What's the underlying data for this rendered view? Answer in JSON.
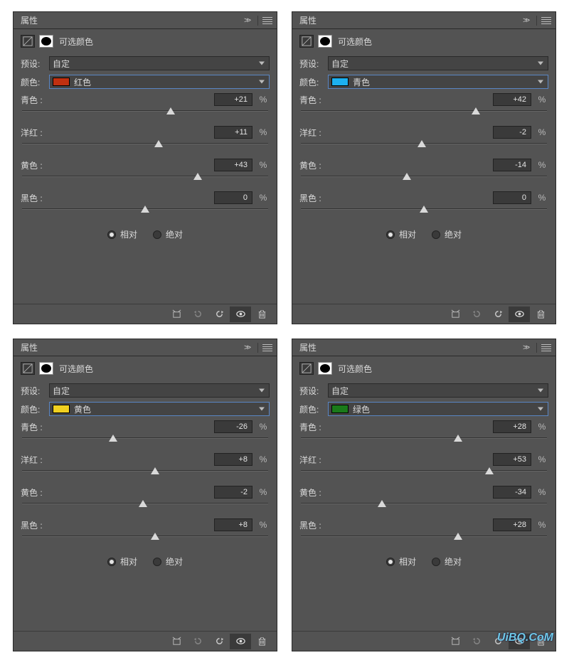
{
  "ui": {
    "panel_title": "属性",
    "subtitle": "可选颜色",
    "preset_label": "预设:",
    "preset_value": "自定",
    "color_label": "颜色:",
    "cyan_label": "青色 :",
    "magenta_label": "洋红 :",
    "yellow_label": "黄色 :",
    "black_label": "黑色 :",
    "relative": "相对",
    "absolute": "绝对",
    "percent": "%"
  },
  "panels": [
    {
      "color_name": "红色",
      "swatch": "#c03010",
      "cyan": 21,
      "magenta": 11,
      "yellow": 43,
      "black": 0
    },
    {
      "color_name": "青色",
      "swatch": "#1cb0f0",
      "cyan": 42,
      "magenta": -2,
      "yellow": -14,
      "black": 0
    },
    {
      "color_name": "黄色",
      "swatch": "#f0d020",
      "cyan": -26,
      "magenta": 8,
      "yellow": -2,
      "black": 8
    },
    {
      "color_name": "绿色",
      "swatch": "#1a7a1a",
      "cyan": 28,
      "magenta": 53,
      "yellow": -34,
      "black": 28
    }
  ],
  "watermark": "UiBQ.CoM"
}
